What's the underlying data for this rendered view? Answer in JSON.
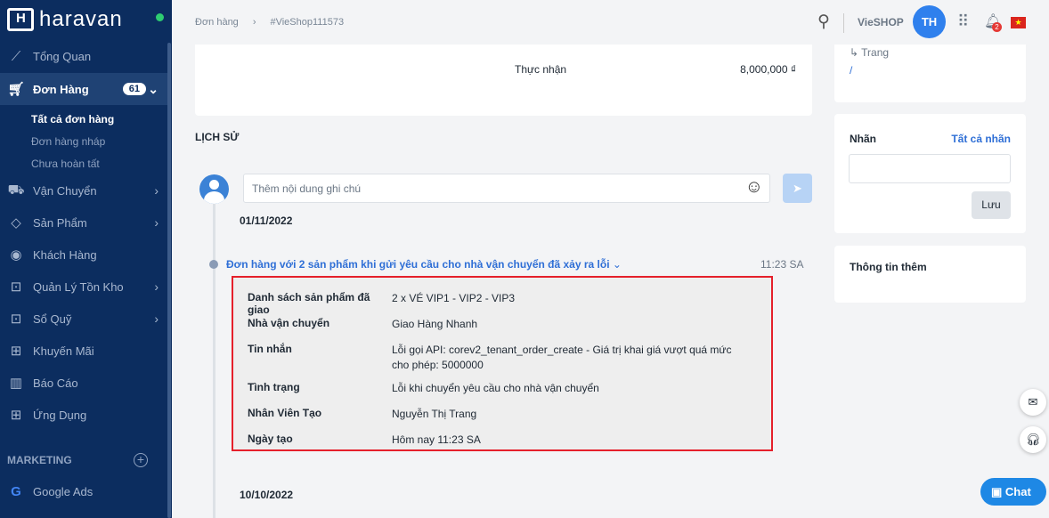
{
  "brand": "haravan",
  "sidebar": {
    "items": [
      {
        "label": "Tổng Quan",
        "icon": "trend-icon"
      },
      {
        "label": "Đơn Hàng",
        "icon": "cart-icon",
        "badge": "61"
      },
      {
        "label": "Vận Chuyển",
        "icon": "truck-icon"
      },
      {
        "label": "Sản Phẩm",
        "icon": "tag-icon"
      },
      {
        "label": "Khách Hàng",
        "icon": "user-circle-icon"
      },
      {
        "label": "Quản Lý Tồn Kho",
        "icon": "inventory-icon"
      },
      {
        "label": "Sổ Quỹ",
        "icon": "cashbook-icon"
      },
      {
        "label": "Khuyến Mãi",
        "icon": "gift-icon"
      },
      {
        "label": "Báo Cáo",
        "icon": "report-icon"
      },
      {
        "label": "Ứng Dụng",
        "icon": "apps-icon"
      }
    ],
    "sub_items": [
      "Tất cả đơn hàng",
      "Đơn hàng nháp",
      "Chưa hoàn tất"
    ],
    "marketing_label": "MARKETING",
    "marketing_items": [
      {
        "label": "Google Ads"
      }
    ]
  },
  "header": {
    "breadcrumb": [
      "Đơn hàng",
      "#VieShop111573"
    ],
    "shop": "VieSHOP",
    "avatar": "TH",
    "notifications": "2"
  },
  "summary": {
    "label": "Thực nhận",
    "value": "8,000,000 ₫"
  },
  "history": {
    "title": "LỊCH SỬ",
    "placeholder": "Thêm nội dung ghi chú",
    "date1": "01/11/2022",
    "event": {
      "title": "Đơn hàng với 2 sản phẩm khi gửi yêu cầu cho nhà vận chuyển đã xảy ra lỗi",
      "time": "11:23 SA",
      "rows": [
        {
          "k": "Danh sách sản phẩm đã giao",
          "v": "2 x VÉ VIP1 - VIP2 - VIP3"
        },
        {
          "k": "Nhà vận chuyển",
          "v": "Giao Hàng Nhanh"
        },
        {
          "k": "Tin nhắn",
          "v": "Lỗi gọi API: corev2_tenant_order_create - Giá trị khai giá vượt quá mức cho phép: 5000000"
        },
        {
          "k": "Tình trạng",
          "v": "Lỗi khi chuyển yêu cầu cho nhà vận chuyển"
        },
        {
          "k": "Nhân Viên Tạo",
          "v": "Nguyễn Thị Trang"
        },
        {
          "k": "Ngày tạo",
          "v": "Hôm nay 11:23 SA"
        }
      ]
    },
    "date2": "10/10/2022"
  },
  "right": {
    "trang": "Trang",
    "slash": "/",
    "tags_title": "Nhãn",
    "all_tags": "Tất cả nhãn",
    "save": "Lưu",
    "more_info": "Thông tin thêm"
  },
  "chat": "Chat"
}
